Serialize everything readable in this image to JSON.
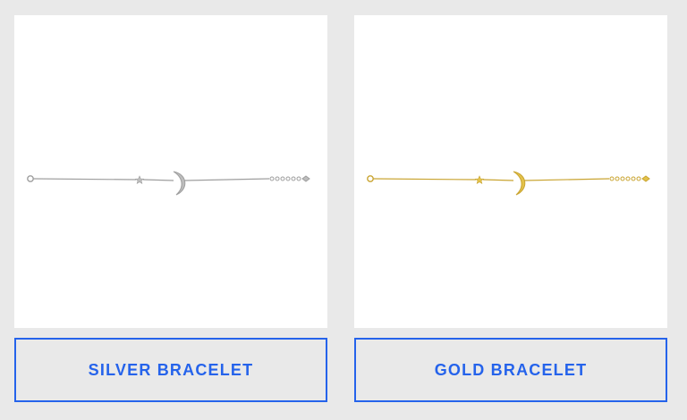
{
  "products": [
    {
      "name": "SILVER BRACELET",
      "metal_color": "#bdbdbd",
      "accent_color": "#9e9e9e",
      "image_icon": "bracelet-moon-star-image"
    },
    {
      "name": "GOLD BRACELET",
      "metal_color": "#e3c24a",
      "accent_color": "#c9a431",
      "image_icon": "bracelet-moon-star-image"
    }
  ],
  "theme": {
    "accent": "#2563eb",
    "background": "#e9e9e9"
  }
}
